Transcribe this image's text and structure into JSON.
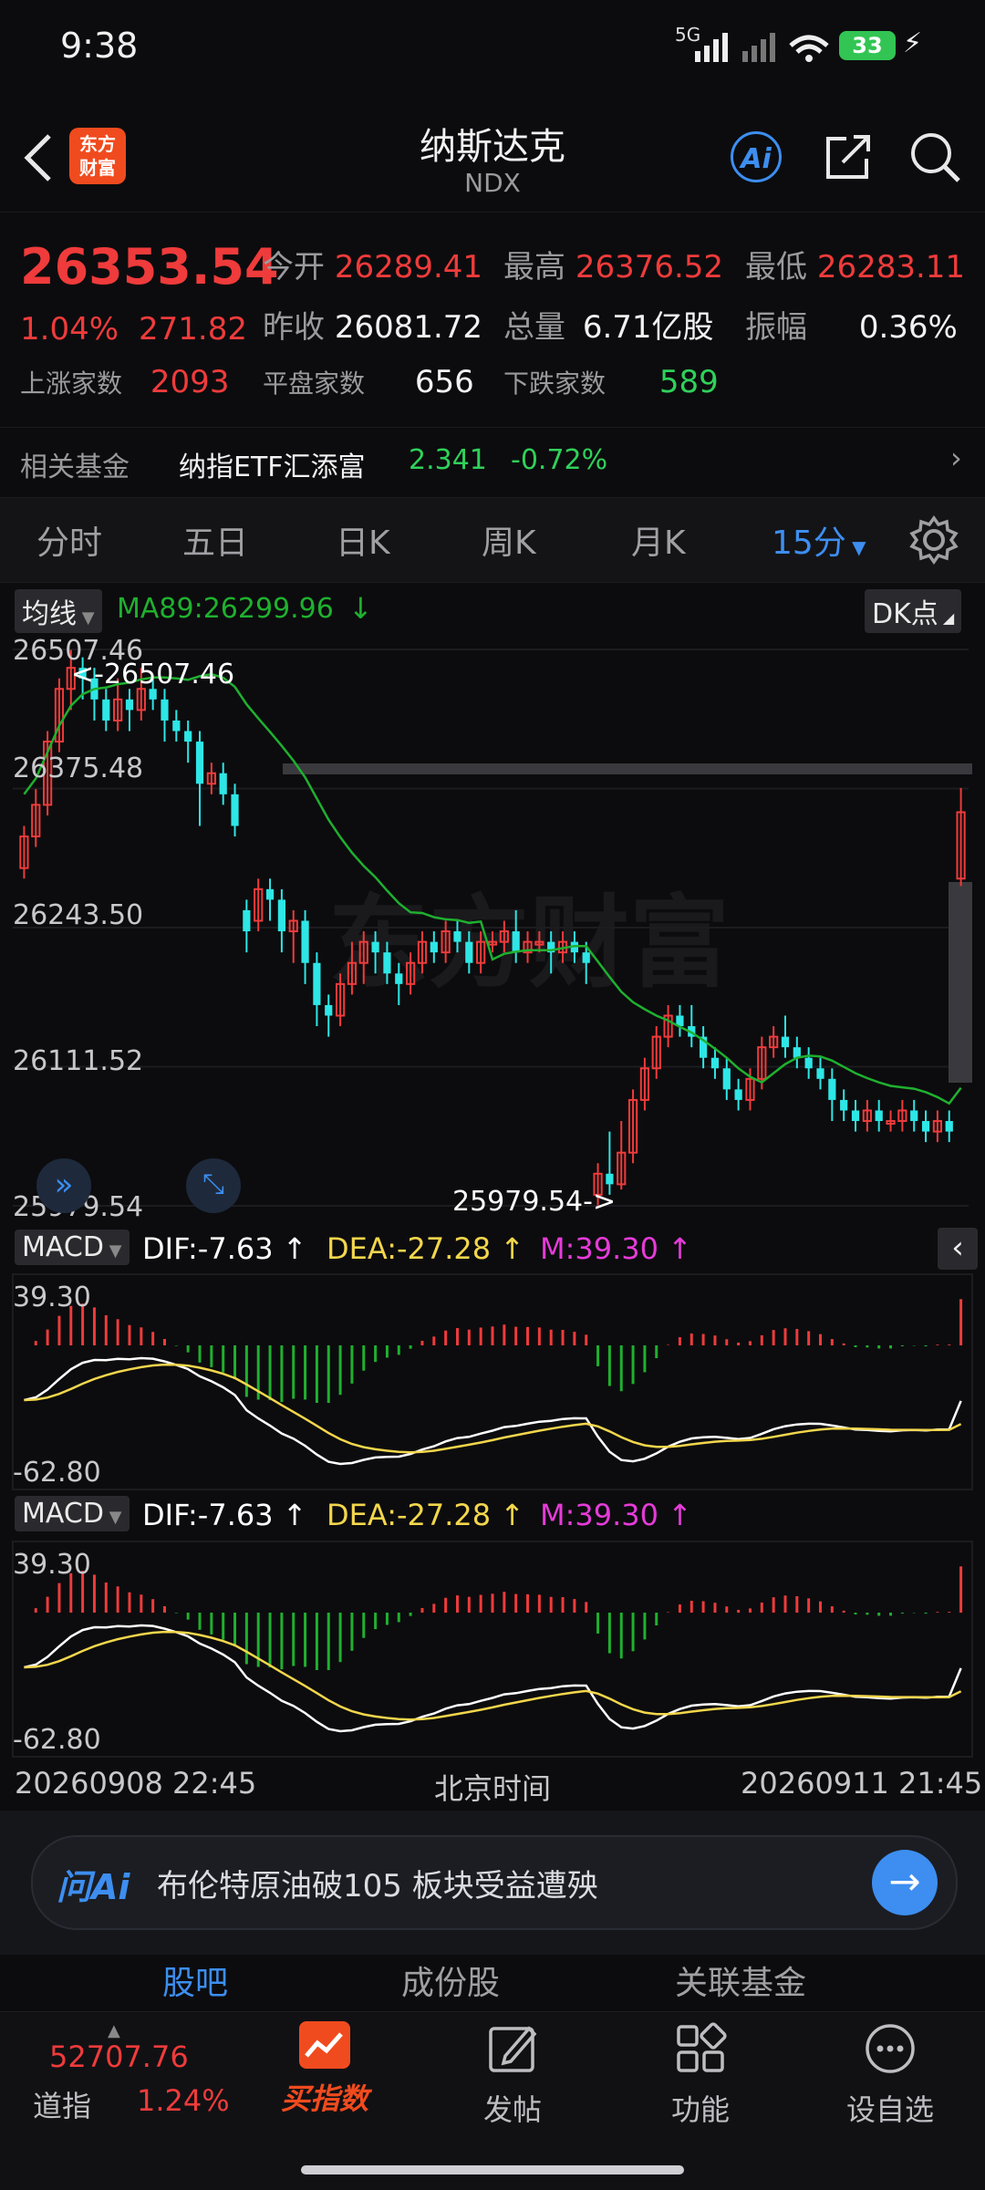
{
  "status_bar": {
    "time": "9:38",
    "battery": "33",
    "network": "5G"
  },
  "header": {
    "title": "纳斯达克",
    "subtitle": "NDX",
    "logo_text": "东方\n财富"
  },
  "quote": {
    "price": "26353.54",
    "change_pct": "1.04%",
    "change_amt": "271.82",
    "stats": [
      {
        "label": "今开",
        "value": "26289.41",
        "color": "red"
      },
      {
        "label": "最高",
        "value": "26376.52",
        "color": "red"
      },
      {
        "label": "最低",
        "value": "26283.11",
        "color": "red"
      },
      {
        "label": "昨收",
        "value": "26081.72",
        "color": "white"
      },
      {
        "label": "总量",
        "value": "6.71亿股",
        "color": "white"
      },
      {
        "label": "振幅",
        "value": "0.36%",
        "color": "white"
      }
    ],
    "breadth": [
      {
        "label": "上涨家数",
        "value": "2093",
        "color": "red"
      },
      {
        "label": "平盘家数",
        "value": "656",
        "color": "white"
      },
      {
        "label": "下跌家数",
        "value": "589",
        "color": "green"
      }
    ]
  },
  "fund": {
    "label": "相关基金",
    "name": "纳指ETF汇添富",
    "price": "2.341",
    "change": "-0.72%"
  },
  "period_tabs": [
    "分时",
    "五日",
    "日K",
    "周K",
    "月K",
    "15分"
  ],
  "chart": {
    "ma_selector": "均线",
    "ma_label": "MA89:26299.96",
    "dk_label": "DK点",
    "watermark": "东方财富",
    "y_ticks": [
      "26507.46",
      "26375.48",
      "26243.50",
      "26111.52",
      "25979.54"
    ],
    "high_annotation": "<-26507.46",
    "low_annotation": "25979.54->",
    "macd_panels": [
      {
        "name": "MACD",
        "dif": "DIF:-7.63",
        "dea": "DEA:-27.28",
        "m": "M:39.30",
        "top": "39.30",
        "bottom": "-62.80"
      },
      {
        "name": "MACD",
        "dif": "DIF:-7.63",
        "dea": "DEA:-27.28",
        "m": "M:39.30",
        "top": "39.30",
        "bottom": "-62.80"
      }
    ],
    "x_start": "20260908 22:45",
    "x_mid": "北京时间",
    "x_end": "20260911 21:45"
  },
  "chart_data": {
    "type": "candlestick",
    "ylim": [
      25979.54,
      26507.46
    ],
    "ma89_last": 26299.96,
    "candles": [
      [
        26300,
        26330,
        26290,
        26340
      ],
      [
        26330,
        26360,
        26320,
        26375
      ],
      [
        26360,
        26420,
        26350,
        26430
      ],
      [
        26420,
        26470,
        26410,
        26480
      ],
      [
        26470,
        26490,
        26450,
        26507
      ],
      [
        26490,
        26480,
        26460,
        26500
      ],
      [
        26480,
        26460,
        26440,
        26490
      ],
      [
        26460,
        26440,
        26430,
        26470
      ],
      [
        26440,
        26460,
        26430,
        26480
      ],
      [
        26460,
        26450,
        26430,
        26470
      ],
      [
        26450,
        26470,
        26440,
        26490
      ],
      [
        26470,
        26460,
        26450,
        26480
      ],
      [
        26460,
        26440,
        26420,
        26470
      ],
      [
        26440,
        26430,
        26420,
        26450
      ],
      [
        26430,
        26420,
        26400,
        26440
      ],
      [
        26420,
        26380,
        26340,
        26430
      ],
      [
        26380,
        26390,
        26370,
        26400
      ],
      [
        26390,
        26370,
        26360,
        26400
      ],
      [
        26370,
        26340,
        26330,
        26380
      ],
      [
        26260,
        26240,
        26220,
        26270
      ],
      [
        26250,
        26280,
        26240,
        26290
      ],
      [
        26280,
        26270,
        26250,
        26290
      ],
      [
        26270,
        26240,
        26220,
        26280
      ],
      [
        26240,
        26250,
        26210,
        26260
      ],
      [
        26250,
        26210,
        26190,
        26260
      ],
      [
        26210,
        26170,
        26150,
        26220
      ],
      [
        26170,
        26160,
        26140,
        26180
      ],
      [
        26160,
        26190,
        26150,
        26200
      ],
      [
        26190,
        26210,
        26180,
        26230
      ],
      [
        26210,
        26230,
        26190,
        26240
      ],
      [
        26230,
        26220,
        26200,
        26240
      ],
      [
        26220,
        26200,
        26190,
        26230
      ],
      [
        26200,
        26190,
        26170,
        26210
      ],
      [
        26190,
        26210,
        26180,
        26220
      ],
      [
        26210,
        26230,
        26200,
        26240
      ],
      [
        26230,
        26220,
        26210,
        26240
      ],
      [
        26220,
        26240,
        26210,
        26250
      ],
      [
        26240,
        26230,
        26220,
        26250
      ],
      [
        26230,
        26210,
        26200,
        26240
      ],
      [
        26210,
        26230,
        26200,
        26240
      ],
      [
        26230,
        26230,
        26220,
        26240
      ],
      [
        26230,
        26240,
        26220,
        26250
      ],
      [
        26240,
        26220,
        26210,
        26260
      ],
      [
        26220,
        26230,
        26210,
        26240
      ],
      [
        26230,
        26230,
        26220,
        26240
      ],
      [
        26230,
        26220,
        26200,
        26240
      ],
      [
        26220,
        26230,
        26210,
        26240
      ],
      [
        26230,
        26220,
        26210,
        26240
      ],
      [
        26220,
        26210,
        26190,
        26230
      ],
      [
        25990,
        26010,
        25980,
        26020
      ],
      [
        26010,
        26000,
        25990,
        26050
      ],
      [
        26000,
        26030,
        25995,
        26060
      ],
      [
        26030,
        26080,
        26020,
        26090
      ],
      [
        26080,
        26110,
        26070,
        26120
      ],
      [
        26110,
        26140,
        26100,
        26150
      ],
      [
        26140,
        26160,
        26130,
        26170
      ],
      [
        26160,
        26150,
        26140,
        26170
      ],
      [
        26150,
        26140,
        26130,
        26170
      ],
      [
        26140,
        26120,
        26110,
        26150
      ],
      [
        26120,
        26110,
        26100,
        26130
      ],
      [
        26110,
        26090,
        26080,
        26120
      ],
      [
        26090,
        26080,
        26070,
        26100
      ],
      [
        26080,
        26100,
        26070,
        26110
      ],
      [
        26100,
        26130,
        26090,
        26140
      ],
      [
        26130,
        26140,
        26120,
        26150
      ],
      [
        26140,
        26130,
        26120,
        26160
      ],
      [
        26130,
        26120,
        26110,
        26140
      ],
      [
        26120,
        26110,
        26100,
        26130
      ],
      [
        26110,
        26100,
        26090,
        26120
      ],
      [
        26100,
        26080,
        26060,
        26110
      ],
      [
        26080,
        26070,
        26060,
        26090
      ],
      [
        26070,
        26060,
        26050,
        26080
      ],
      [
        26060,
        26070,
        26050,
        26080
      ],
      [
        26070,
        26060,
        26050,
        26080
      ],
      [
        26060,
        26060,
        26050,
        26070
      ],
      [
        26060,
        26070,
        26050,
        26080
      ],
      [
        26070,
        26060,
        26050,
        26080
      ],
      [
        26060,
        26050,
        26040,
        26070
      ],
      [
        26050,
        26060,
        26040,
        26070
      ],
      [
        26060,
        26050,
        26040,
        26070
      ],
      [
        26290,
        26353,
        26283,
        26376
      ]
    ]
  },
  "ai_bar": {
    "prefix": "问Ai",
    "text": "布伦特原油破105 板块受益遭殃"
  },
  "nav_tabs": [
    "股吧",
    "成份股",
    "关联基金"
  ],
  "bottom_nav": {
    "index_value": "52707.76",
    "index_name": "道指",
    "index_change": "1.24%",
    "items": [
      "买指数",
      "发帖",
      "功能",
      "设自选"
    ]
  },
  "colors": {
    "up": "#ef3b3b",
    "down": "#2ee6e6",
    "ma": "#1fb02f",
    "dea": "#f3d64c",
    "m": "#e63bd9",
    "accent": "#3d8ef0"
  }
}
